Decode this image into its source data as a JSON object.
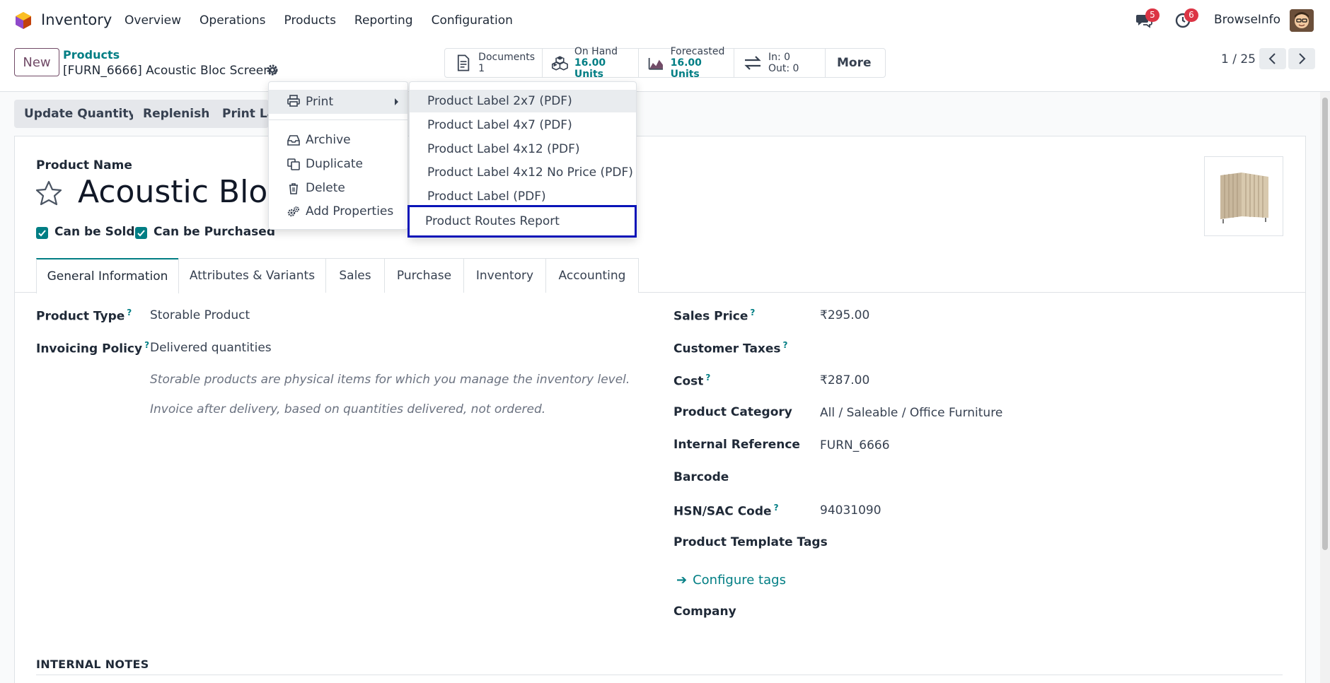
{
  "navbar": {
    "app_name": "Inventory",
    "menu": [
      "Overview",
      "Operations",
      "Products",
      "Reporting",
      "Configuration"
    ],
    "messages_count": "5",
    "activities_count": "6",
    "company": "BrowseInfo"
  },
  "control": {
    "new_label": "New",
    "breadcrumb_parent": "Products",
    "breadcrumb_current": "[FURN_6666] Acoustic Bloc Screens",
    "smart_buttons": {
      "documents": {
        "label": "Documents",
        "value": "1"
      },
      "on_hand": {
        "label": "On Hand",
        "value": "16.00 Units"
      },
      "forecasted": {
        "label": "Forecasted",
        "value": "16.00 Units"
      },
      "in_out": {
        "in": "In: 0",
        "out": "Out: 0"
      },
      "more": "More"
    },
    "pager": "1 / 25"
  },
  "actions": {
    "update_quantity": "Update Quantity",
    "replenish": "Replenish",
    "print_labels": "Print Lal"
  },
  "gear_menu": {
    "print": "Print",
    "archive": "Archive",
    "duplicate": "Duplicate",
    "delete": "Delete",
    "add_properties": "Add Properties"
  },
  "print_submenu": [
    "Product Label 2x7 (PDF)",
    "Product Label 4x7 (PDF)",
    "Product Label 4x12 (PDF)",
    "Product Label 4x12 No Price (PDF)",
    "Product Label (PDF)",
    "Product Routes Report"
  ],
  "form": {
    "product_name_label": "Product Name",
    "product_title": "Acoustic Bloc S",
    "can_be_sold": "Can be Sold",
    "can_be_purchased": "Can be Purchased",
    "tabs": [
      "General Information",
      "Attributes & Variants",
      "Sales",
      "Purchase",
      "Inventory",
      "Accounting"
    ],
    "left": {
      "product_type_label": "Product Type",
      "product_type_value": "Storable Product",
      "invoicing_policy_label": "Invoicing Policy",
      "invoicing_policy_value": "Delivered quantities",
      "help_storable": "Storable products are physical items for which you manage the inventory level.",
      "help_invoice": "Invoice after delivery, based on quantities delivered, not ordered."
    },
    "right": {
      "sales_price_label": "Sales Price",
      "sales_price_value": "₹295.00",
      "customer_taxes_label": "Customer Taxes",
      "cost_label": "Cost",
      "cost_value": "₹287.00",
      "product_category_label": "Product Category",
      "product_category_value": "All / Saleable / Office Furniture",
      "internal_reference_label": "Internal Reference",
      "internal_reference_value": "FURN_6666",
      "barcode_label": "Barcode",
      "hsn_label": "HSN/SAC Code",
      "hsn_value": "94031090",
      "template_tags_label": "Product Template Tags",
      "configure_tags": "Configure tags",
      "company_label": "Company"
    },
    "help_marker": "?",
    "internal_notes": "INTERNAL NOTES"
  },
  "colors": {
    "brand_purple": "#714b67",
    "accent_teal": "#017e84",
    "badge_red": "#dc3545",
    "highlight_box": "#0a14b8"
  }
}
